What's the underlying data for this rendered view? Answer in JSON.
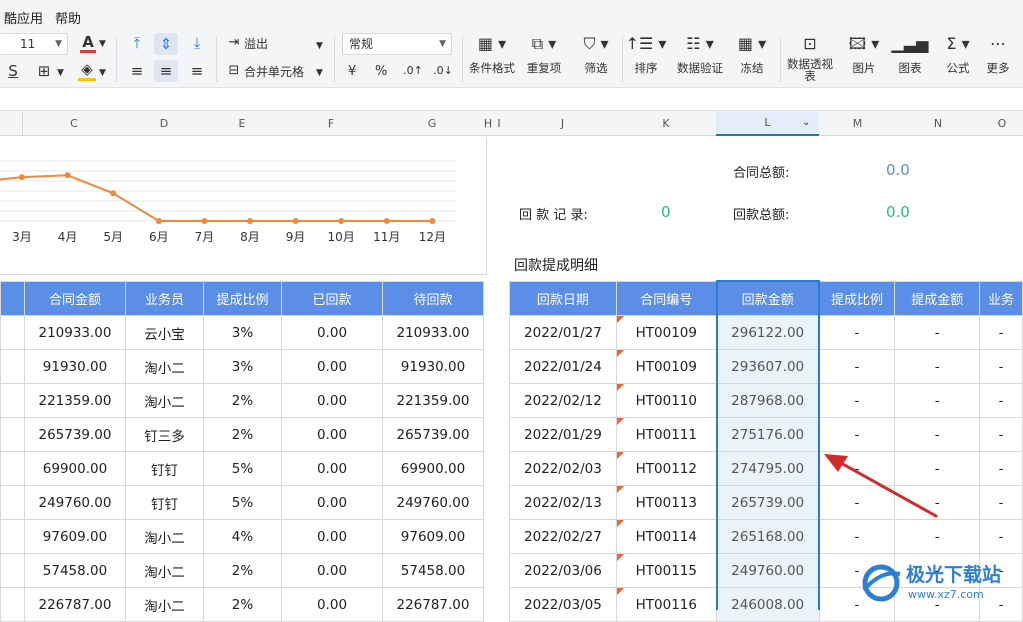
{
  "menu": {
    "items": [
      "酷应用",
      "帮助"
    ]
  },
  "toolbar": {
    "font_size": "11",
    "number_format": "常规",
    "overflow_label": "溢出",
    "merge_label": "合并单元格",
    "currency_symbol": "¥",
    "percent_symbol": "%",
    "buttons": [
      {
        "label": "条件格式",
        "icon": "conditional-format-icon"
      },
      {
        "label": "重复项",
        "icon": "duplicate-icon"
      },
      {
        "label": "筛选",
        "icon": "filter-icon"
      },
      {
        "label": "排序",
        "icon": "sort-icon"
      },
      {
        "label": "数据验证",
        "icon": "validation-icon"
      },
      {
        "label": "冻结",
        "icon": "freeze-icon"
      },
      {
        "label": "数据透视表",
        "icon": "pivot-icon"
      },
      {
        "label": "图片",
        "icon": "image-icon"
      },
      {
        "label": "图表",
        "icon": "chart-icon"
      },
      {
        "label": "公式",
        "icon": "sigma-icon"
      },
      {
        "label": "更多",
        "icon": "more-icon"
      }
    ]
  },
  "columns": [
    "C",
    "D",
    "E",
    "F",
    "G",
    "H",
    "I",
    "J",
    "K",
    "L",
    "M",
    "N",
    "O"
  ],
  "selected_column": "L",
  "chart_data": {
    "type": "line",
    "categories": [
      "3月",
      "4月",
      "5月",
      "6月",
      "7月",
      "8月",
      "9月",
      "10月",
      "11月",
      "12月"
    ],
    "series": [
      {
        "values": [
          190000,
          198000,
          120000,
          0,
          0,
          0,
          0,
          0,
          0,
          0
        ]
      }
    ],
    "line_color": "#ed8a3c",
    "grid": true
  },
  "summary": {
    "contract_total_label": "合同总额:",
    "contract_total_value": "0.0",
    "payment_record_label": "回 款 记 录:",
    "payment_record_value": "0",
    "payment_total_label": "回款总额:",
    "payment_total_value": "0.0"
  },
  "section_title": "回款提成明细",
  "left_table": {
    "headers": [
      "合同金额",
      "业务员",
      "提成比例",
      "已回款",
      "待回款"
    ],
    "rows": [
      [
        "210933.00",
        "云小宝",
        "3%",
        "0.00",
        "210933.00"
      ],
      [
        "91930.00",
        "淘小二",
        "3%",
        "0.00",
        "91930.00"
      ],
      [
        "221359.00",
        "淘小二",
        "2%",
        "0.00",
        "221359.00"
      ],
      [
        "265739.00",
        "钉三多",
        "2%",
        "0.00",
        "265739.00"
      ],
      [
        "69900.00",
        "钉钉",
        "5%",
        "0.00",
        "69900.00"
      ],
      [
        "249760.00",
        "钉钉",
        "5%",
        "0.00",
        "249760.00"
      ],
      [
        "97609.00",
        "淘小二",
        "4%",
        "0.00",
        "97609.00"
      ],
      [
        "57458.00",
        "淘小二",
        "2%",
        "0.00",
        "57458.00"
      ],
      [
        "226787.00",
        "淘小二",
        "2%",
        "0.00",
        "226787.00"
      ]
    ]
  },
  "right_table": {
    "headers": [
      "回款日期",
      "合同编号",
      "回款金额",
      "提成比例",
      "提成金额",
      "业务"
    ],
    "rows": [
      [
        "2022/01/27",
        "HT00109",
        "296122.00",
        "-",
        "-",
        "-"
      ],
      [
        "2022/01/24",
        "HT00109",
        "293607.00",
        "-",
        "-",
        "-"
      ],
      [
        "2022/02/12",
        "HT00110",
        "287968.00",
        "-",
        "-",
        "-"
      ],
      [
        "2022/01/29",
        "HT00111",
        "275176.00",
        "-",
        "-",
        "-"
      ],
      [
        "2022/02/03",
        "HT00112",
        "274795.00",
        "-",
        "-",
        "-"
      ],
      [
        "2022/02/13",
        "HT00113",
        "265739.00",
        "-",
        "-",
        "-"
      ],
      [
        "2022/02/27",
        "HT00114",
        "265168.00",
        "-",
        "-",
        "-"
      ],
      [
        "2022/03/06",
        "HT00115",
        "249760.00",
        "-",
        "-",
        "-"
      ],
      [
        "2022/03/05",
        "HT00116",
        "246008.00",
        "-",
        "-",
        "-"
      ]
    ]
  },
  "watermark": {
    "text": "极光下载站",
    "url": "www.xz7.com"
  },
  "colors": {
    "header_blue": "#5b8ee6",
    "green": "#25c07a",
    "blue_value": "#5b8ee6",
    "arrow": "#d42a2a"
  }
}
